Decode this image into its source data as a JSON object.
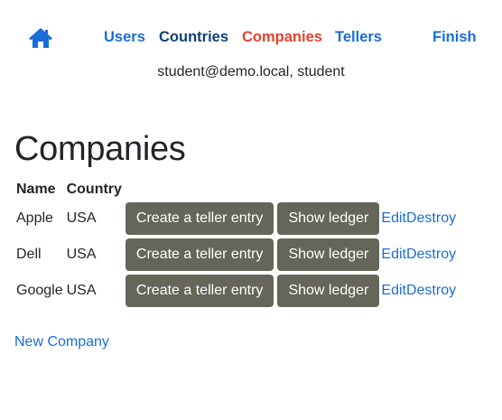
{
  "nav": {
    "home_icon": "home-icon",
    "items": [
      {
        "label": "Users",
        "color": "#1a6ed8"
      },
      {
        "label": "Countries",
        "color": "#123f7a"
      },
      {
        "label": "Companies",
        "color": "#e8412c"
      },
      {
        "label": "Tellers",
        "color": "#1a6ed8"
      },
      {
        "label": "Finish",
        "color": "#1a6ed8"
      }
    ]
  },
  "user_info": "student@demo.local, student",
  "page_title": "Companies",
  "table": {
    "headers": [
      "Name",
      "Country"
    ],
    "rows": [
      {
        "name": "Apple",
        "country": "USA",
        "teller_label": "Create a teller entry",
        "ledger_label": "Show ledger",
        "edit_label": "Edit",
        "destroy_label": "Destroy"
      },
      {
        "name": "Dell",
        "country": "USA",
        "teller_label": "Create a teller entry",
        "ledger_label": "Show ledger",
        "edit_label": "Edit",
        "destroy_label": "Destroy"
      },
      {
        "name": "Google",
        "country": "USA",
        "teller_label": "Create a teller entry",
        "ledger_label": "Show ledger",
        "edit_label": "Edit",
        "destroy_label": "Destroy"
      }
    ]
  },
  "new_company_label": "New Company",
  "colors": {
    "link": "#1a6ed8",
    "active": "#e8412c",
    "visited": "#123f7a",
    "button_bg": "#656559"
  }
}
